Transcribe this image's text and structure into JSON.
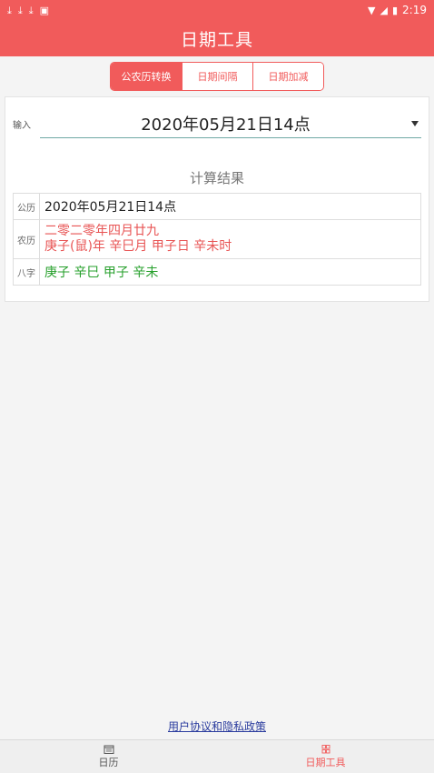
{
  "status": {
    "time": "2:19",
    "left_icons": [
      "download-icon",
      "download-icon",
      "download-icon",
      "a-icon"
    ]
  },
  "header": {
    "title": "日期工具"
  },
  "tabs": [
    {
      "label": "公农历转换",
      "active": true
    },
    {
      "label": "日期间隔",
      "active": false
    },
    {
      "label": "日期加减",
      "active": false
    }
  ],
  "input": {
    "label": "输入",
    "value": "2020年05月21日14点"
  },
  "results": {
    "title": "计算结果",
    "rows": [
      {
        "label": "公历",
        "lines": [
          "2020年05月21日14点"
        ]
      },
      {
        "label": "农历",
        "lines": [
          "二零二零年四月廿九",
          "庚子(鼠)年 辛巳月 甲子日 辛未时"
        ]
      },
      {
        "label": "八字",
        "lines": [
          "庚子 辛巳 甲子 辛未"
        ]
      }
    ]
  },
  "footer": {
    "link": "用户协议和隐私政策"
  },
  "nav": [
    {
      "label": "日历",
      "active": false,
      "icon": "calendar-icon"
    },
    {
      "label": "日期工具",
      "active": true,
      "icon": "grid-icon"
    }
  ],
  "colors": {
    "accent": "#f15b5b",
    "green": "#27a02c",
    "link": "#2b3c9e"
  }
}
